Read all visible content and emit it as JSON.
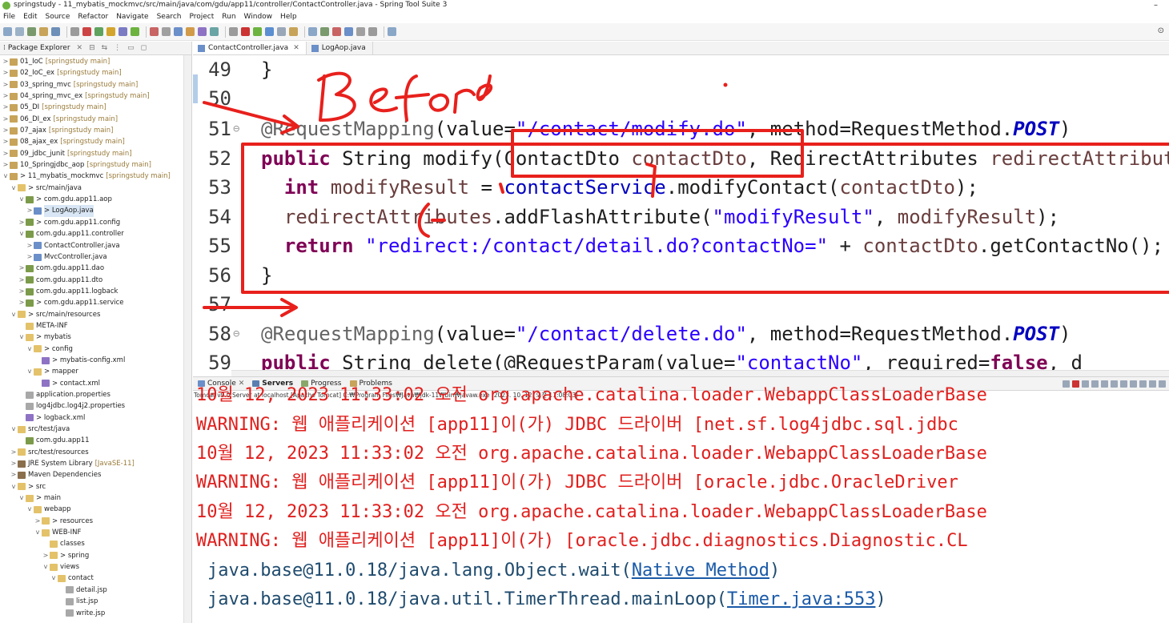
{
  "window": {
    "title": "springstudy - 11_mybatis_mockmvc/src/main/java/com/gdu/app11/controller/ContactController.java - Spring Tool Suite 3"
  },
  "menu": [
    "File",
    "Edit",
    "Source",
    "Refactor",
    "Navigate",
    "Search",
    "Project",
    "Run",
    "Window",
    "Help"
  ],
  "explorer": {
    "title": "Package Explorer",
    "items": [
      {
        "label": "01_IoC",
        "meta": "[springstudy main]",
        "depth": 0,
        "icon": "project",
        "twisty": ">"
      },
      {
        "label": "02_IoC_ex",
        "meta": "[springstudy main]",
        "depth": 0,
        "icon": "project",
        "twisty": ">"
      },
      {
        "label": "03_spring_mvc",
        "meta": "[springstudy main]",
        "depth": 0,
        "icon": "project",
        "twisty": ">"
      },
      {
        "label": "04_spring_mvc_ex",
        "meta": "[springstudy main]",
        "depth": 0,
        "icon": "project",
        "twisty": ">"
      },
      {
        "label": "05_DI",
        "meta": "[springstudy main]",
        "depth": 0,
        "icon": "project",
        "twisty": ">"
      },
      {
        "label": "06_DI_ex",
        "meta": "[springstudy main]",
        "depth": 0,
        "icon": "project",
        "twisty": ">"
      },
      {
        "label": "07_ajax",
        "meta": "[springstudy main]",
        "depth": 0,
        "icon": "project",
        "twisty": ">"
      },
      {
        "label": "08_ajax_ex",
        "meta": "[springstudy main]",
        "depth": 0,
        "icon": "project",
        "twisty": ">"
      },
      {
        "label": "09_jdbc_junit",
        "meta": "[springstudy main]",
        "depth": 0,
        "icon": "project",
        "twisty": ">"
      },
      {
        "label": "10_Springjdbc_aop",
        "meta": "[springstudy main]",
        "depth": 0,
        "icon": "project",
        "twisty": ">"
      },
      {
        "label": "> 11_mybatis_mockmvc",
        "meta": "[springstudy main]",
        "depth": 0,
        "icon": "project",
        "twisty": "v"
      },
      {
        "label": "> src/main/java",
        "meta": "",
        "depth": 1,
        "icon": "folder",
        "twisty": "v"
      },
      {
        "label": "> com.gdu.app11.aop",
        "meta": "",
        "depth": 2,
        "icon": "pkg",
        "twisty": "v"
      },
      {
        "label": "> LogAop.java",
        "meta": "",
        "depth": 3,
        "icon": "java",
        "twisty": ">",
        "selected": true
      },
      {
        "label": "> com.gdu.app11.config",
        "meta": "",
        "depth": 2,
        "icon": "pkg",
        "twisty": ">"
      },
      {
        "label": "com.gdu.app11.controller",
        "meta": "",
        "depth": 2,
        "icon": "pkg",
        "twisty": "v"
      },
      {
        "label": "ContactController.java",
        "meta": "",
        "depth": 3,
        "icon": "java",
        "twisty": ">"
      },
      {
        "label": "MvcController.java",
        "meta": "",
        "depth": 3,
        "icon": "java",
        "twisty": ">"
      },
      {
        "label": "com.gdu.app11.dao",
        "meta": "",
        "depth": 2,
        "icon": "pkg",
        "twisty": ">"
      },
      {
        "label": "com.gdu.app11.dto",
        "meta": "",
        "depth": 2,
        "icon": "pkg",
        "twisty": ">"
      },
      {
        "label": "com.gdu.app11.logback",
        "meta": "",
        "depth": 2,
        "icon": "pkg",
        "twisty": ">"
      },
      {
        "label": "> com.gdu.app11.service",
        "meta": "",
        "depth": 2,
        "icon": "pkg",
        "twisty": ">"
      },
      {
        "label": "> src/main/resources",
        "meta": "",
        "depth": 1,
        "icon": "folder",
        "twisty": "v"
      },
      {
        "label": "META-INF",
        "meta": "",
        "depth": 2,
        "icon": "folder",
        "twisty": ""
      },
      {
        "label": "> mybatis",
        "meta": "",
        "depth": 2,
        "icon": "folder",
        "twisty": "v"
      },
      {
        "label": "> config",
        "meta": "",
        "depth": 3,
        "icon": "folder",
        "twisty": "v"
      },
      {
        "label": "> mybatis-config.xml",
        "meta": "",
        "depth": 4,
        "icon": "xml",
        "twisty": ""
      },
      {
        "label": "> mapper",
        "meta": "",
        "depth": 3,
        "icon": "folder",
        "twisty": "v"
      },
      {
        "label": "> contact.xml",
        "meta": "",
        "depth": 4,
        "icon": "xml",
        "twisty": ""
      },
      {
        "label": "application.properties",
        "meta": "",
        "depth": 2,
        "icon": "file",
        "twisty": ""
      },
      {
        "label": "log4jdbc.log4j2.properties",
        "meta": "",
        "depth": 2,
        "icon": "file",
        "twisty": ""
      },
      {
        "label": "> logback.xml",
        "meta": "",
        "depth": 2,
        "icon": "xml",
        "twisty": ""
      },
      {
        "label": "src/test/java",
        "meta": "",
        "depth": 1,
        "icon": "folder",
        "twisty": "v"
      },
      {
        "label": "com.gdu.app11",
        "meta": "",
        "depth": 2,
        "icon": "pkg",
        "twisty": ""
      },
      {
        "label": "src/test/resources",
        "meta": "",
        "depth": 1,
        "icon": "folder",
        "twisty": ">"
      },
      {
        "label": "JRE System Library",
        "meta": "[JavaSE-11]",
        "depth": 1,
        "icon": "lib",
        "twisty": ">"
      },
      {
        "label": "Maven Dependencies",
        "meta": "",
        "depth": 1,
        "icon": "lib",
        "twisty": ">"
      },
      {
        "label": "> src",
        "meta": "",
        "depth": 1,
        "icon": "folder",
        "twisty": "v"
      },
      {
        "label": "> main",
        "meta": "",
        "depth": 2,
        "icon": "folder",
        "twisty": "v"
      },
      {
        "label": "webapp",
        "meta": "",
        "depth": 3,
        "icon": "folder",
        "twisty": "v"
      },
      {
        "label": "> resources",
        "meta": "",
        "depth": 4,
        "icon": "folder",
        "twisty": ">"
      },
      {
        "label": "WEB-INF",
        "meta": "",
        "depth": 4,
        "icon": "folder",
        "twisty": "v"
      },
      {
        "label": "classes",
        "meta": "",
        "depth": 5,
        "icon": "folder",
        "twisty": ""
      },
      {
        "label": "> spring",
        "meta": "",
        "depth": 5,
        "icon": "folder",
        "twisty": ">"
      },
      {
        "label": "views",
        "meta": "",
        "depth": 5,
        "icon": "folder",
        "twisty": "v"
      },
      {
        "label": "contact",
        "meta": "",
        "depth": 6,
        "icon": "folder",
        "twisty": "v"
      },
      {
        "label": "detail.jsp",
        "meta": "",
        "depth": 7,
        "icon": "file",
        "twisty": ""
      },
      {
        "label": "list.jsp",
        "meta": "",
        "depth": 7,
        "icon": "file",
        "twisty": ""
      },
      {
        "label": "write.jsp",
        "meta": "",
        "depth": 7,
        "icon": "file",
        "twisty": ""
      }
    ]
  },
  "editor": {
    "tabs": [
      {
        "label": "ContactController.java",
        "active": true
      },
      {
        "label": "LogAop.java",
        "active": false
      }
    ],
    "lines": [
      {
        "n": "49",
        "fold": "",
        "tokens": [
          [
            "plain",
            "}"
          ]
        ]
      },
      {
        "n": "50",
        "fold": "",
        "tokens": []
      },
      {
        "n": "51",
        "fold": "⊖",
        "tokens": [
          [
            "ann",
            "@RequestMapping"
          ],
          [
            "plain",
            "(value="
          ],
          [
            "str",
            "\"/contact/modify.do\""
          ],
          [
            "plain",
            ", method=RequestMethod."
          ],
          [
            "const",
            "POST"
          ],
          [
            "plain",
            ")"
          ]
        ]
      },
      {
        "n": "52",
        "fold": "",
        "tokens": [
          [
            "kw",
            "public"
          ],
          [
            "plain",
            " String modify(ContactDto "
          ],
          [
            "var",
            "contactDto"
          ],
          [
            "plain",
            ", RedirectAttributes "
          ],
          [
            "var",
            "redirectAttributes"
          ],
          [
            "plain",
            ") {"
          ]
        ]
      },
      {
        "n": "53",
        "fold": "",
        "tokens": [
          [
            "plain",
            "  "
          ],
          [
            "kw",
            "int"
          ],
          [
            "plain",
            " "
          ],
          [
            "var",
            "modifyResult"
          ],
          [
            "plain",
            " = "
          ],
          [
            "field",
            "contactService"
          ],
          [
            "plain",
            ".modifyContact("
          ],
          [
            "var",
            "contactDto"
          ],
          [
            "plain",
            ");"
          ]
        ]
      },
      {
        "n": "54",
        "fold": "",
        "tokens": [
          [
            "plain",
            "  "
          ],
          [
            "var",
            "redirectAttributes"
          ],
          [
            "plain",
            ".addFlashAttribute("
          ],
          [
            "str",
            "\"modifyResult\""
          ],
          [
            "plain",
            ", "
          ],
          [
            "var",
            "modifyResult"
          ],
          [
            "plain",
            ");"
          ]
        ]
      },
      {
        "n": "55",
        "fold": "",
        "tokens": [
          [
            "plain",
            "  "
          ],
          [
            "kw",
            "return"
          ],
          [
            "plain",
            " "
          ],
          [
            "str",
            "\"redirect:/contact/detail.do?contactNo=\""
          ],
          [
            "plain",
            " + "
          ],
          [
            "var",
            "contactDto"
          ],
          [
            "plain",
            ".getContactNo();"
          ]
        ]
      },
      {
        "n": "56",
        "fold": "",
        "tokens": [
          [
            "plain",
            "}"
          ]
        ]
      },
      {
        "n": "57",
        "fold": "",
        "tokens": []
      },
      {
        "n": "58",
        "fold": "⊖",
        "tokens": [
          [
            "ann",
            "@RequestMapping"
          ],
          [
            "plain",
            "(value="
          ],
          [
            "str",
            "\"/contact/delete.do\""
          ],
          [
            "plain",
            ", method=RequestMethod."
          ],
          [
            "const",
            "POST"
          ],
          [
            "plain",
            ")"
          ]
        ]
      },
      {
        "n": "59",
        "fold": "",
        "tokens": [
          [
            "kw",
            "public"
          ],
          [
            "plain",
            " String delete(@RequestParam(value="
          ],
          [
            "str",
            "\"contactNo\""
          ],
          [
            "plain",
            ", required="
          ],
          [
            "kw",
            "false"
          ],
          [
            "plain",
            ", d"
          ]
        ]
      }
    ],
    "annotation": "Before"
  },
  "console": {
    "tabs": [
      {
        "label": "Console",
        "active": false
      },
      {
        "label": "Servers",
        "active": true
      },
      {
        "label": "Progress",
        "active": false
      },
      {
        "label": "Problems",
        "active": false
      }
    ],
    "description": "Tomcat v9.0 Server at localhost [Apache Tomcat] C:₩Program Files₩Java₩jdk-11₩bin₩javaw.exe  (2023. 10. 12. 오전 11:08:03)",
    "lines": [
      {
        "type": "err",
        "text": "10월 12, 2023 11:33:02 오전 org.apache.catalina.loader.WebappClassLoaderBase"
      },
      {
        "type": "err",
        "text": "WARNING: 웹 애플리케이션 [app11]이(가) JDBC 드라이버 [net.sf.log4jdbc.sql.jdbc"
      },
      {
        "type": "err",
        "text": "10월 12, 2023 11:33:02 오전 org.apache.catalina.loader.WebappClassLoaderBase"
      },
      {
        "type": "err",
        "text": "WARNING: 웹 애플리케이션 [app11]이(가) JDBC 드라이버 [oracle.jdbc.OracleDriver"
      },
      {
        "type": "err",
        "text": "10월 12, 2023 11:33:02 오전 org.apache.catalina.loader.WebappClassLoaderBase"
      },
      {
        "type": "err",
        "text": "WARNING: 웹 애플리케이션 [app11]이(가) [oracle.jdbc.diagnostics.Diagnostic.CL"
      },
      {
        "type": "stack",
        "pre": "java.base@11.0.18/java.lang.Object.wait(",
        "link": "Native Method",
        "post": ")"
      },
      {
        "type": "stack",
        "pre": "java.base@11.0.18/java.util.TimerThread.mainLoop(",
        "link": "Timer.java:553",
        "post": ")"
      }
    ]
  },
  "colors": {
    "annotation_red": "#e8201c",
    "log_error": "#e0201e"
  }
}
